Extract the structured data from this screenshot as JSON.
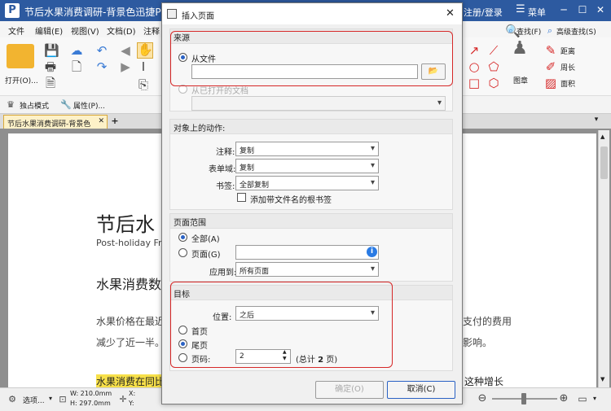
{
  "app": {
    "title": "节后水果消费调研-背景色迅捷PDF",
    "login": "注册/登录",
    "menu_label": "菜单",
    "logo_letter": "P"
  },
  "menubar": [
    "文件",
    "编辑(E)",
    "视图(V)",
    "文档(D)",
    "注释"
  ],
  "ribbon": {
    "open_label": "打开(O)...",
    "find_label": "查找(F)",
    "advanced_find_label": "高级查找(S)",
    "stamp_label": "图章",
    "distance_label": "距离",
    "perimeter_label": "周长",
    "area_label": "面积"
  },
  "subtoolbar": {
    "exclusive_mode": "独占模式",
    "properties": "属性(P)..."
  },
  "doc_tab": {
    "label": "节后水果消费调研-背景色"
  },
  "page": {
    "title": "节后水",
    "subtitle": "Post-holiday Fr",
    "heading": "水果消费数",
    "para1": "水果价格在最近",
    "para1_right": "支付的费用",
    "para2": "减少了近一半。",
    "para2_right": "影响。",
    "highlight": "水果消费在同比",
    "para3_right": "这种增长"
  },
  "statusbar": {
    "select_label": "选项...",
    "width": "W: 210.0mm",
    "height": "H: 297.0mm",
    "x": "X:",
    "y": "Y:"
  },
  "dialog": {
    "title": "插入页面",
    "source": {
      "header": "来源",
      "from_file": "从文件",
      "from_open_doc": "从已打开的文档",
      "file_path": ""
    },
    "actions": {
      "header": "对象上的动作:",
      "annotation_label": "注释:",
      "annotation_value": "复制",
      "formfield_label": "表单域:",
      "formfield_value": "复制",
      "bookmark_label": "书签:",
      "bookmark_value": "全部复制",
      "add_bookmark_checkbox": "添加带文件名的根书签"
    },
    "range": {
      "header": "页面范围",
      "all": "全部(A)",
      "pages": "页面(G)",
      "pages_value": "",
      "apply_to_label": "应用到:",
      "apply_to_value": "所有页面"
    },
    "target": {
      "header": "目标",
      "position_label": "位置:",
      "position_value": "之后",
      "first": "首页",
      "last": "尾页",
      "page_num": "页码:",
      "page_num_value": "2",
      "total_prefix": "(总计 ",
      "total_value": "2",
      "total_suffix": " 页)"
    },
    "ok": "确定(O)",
    "cancel": "取消(C)"
  }
}
